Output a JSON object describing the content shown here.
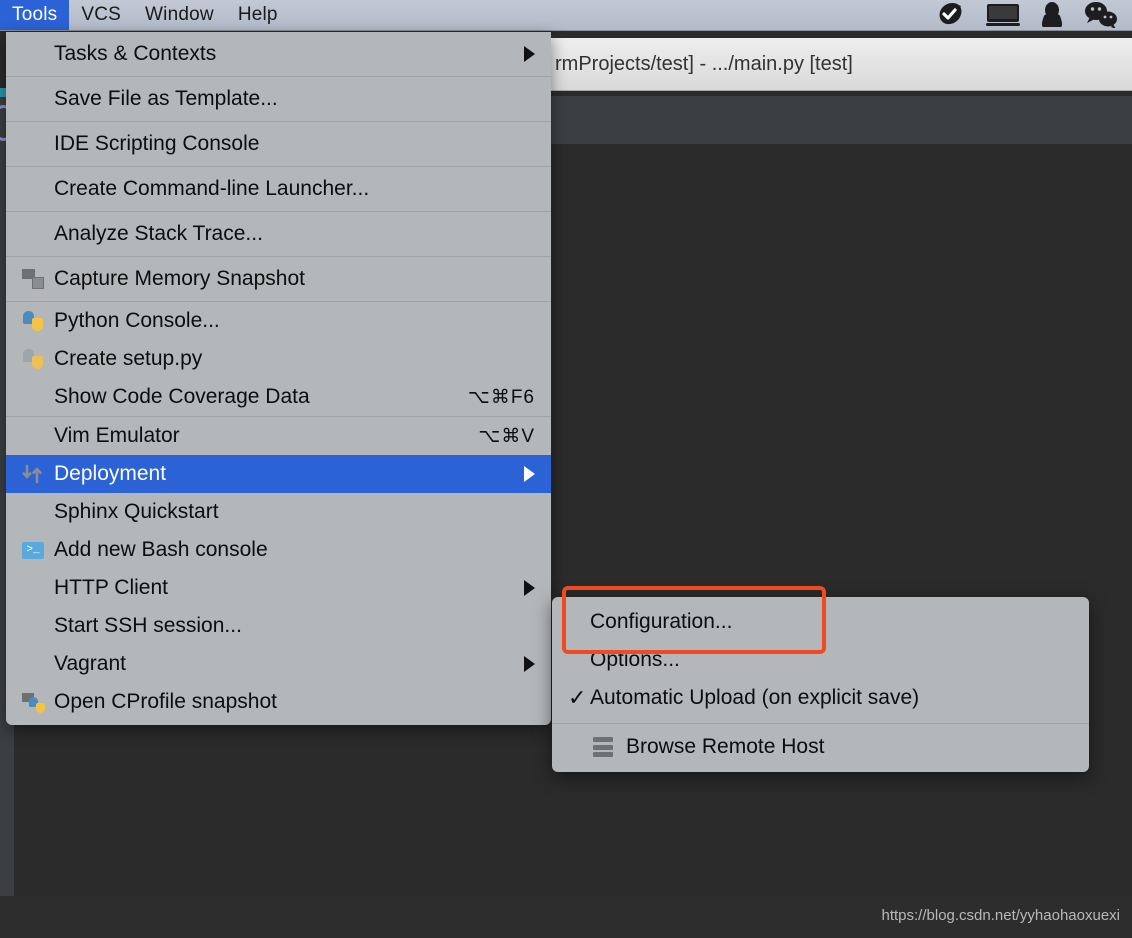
{
  "menubar": {
    "items": [
      {
        "label": "Tools",
        "active": true
      },
      {
        "label": "VCS",
        "active": false
      },
      {
        "label": "Window",
        "active": false
      },
      {
        "label": "Help",
        "active": false
      }
    ],
    "status_icons": [
      "checkmark-badge-icon",
      "display-monitor-icon",
      "qq-penguin-icon",
      "wechat-icon"
    ]
  },
  "titlebar": {
    "text": "rmProjects/test] - .../main.py [test]"
  },
  "tools_menu": {
    "items": [
      {
        "label": "Tasks & Contexts",
        "icon": "none",
        "shortcut": "",
        "submenu": true,
        "separator_below": true,
        "selected": false
      },
      {
        "label": "Save File as Template...",
        "icon": "none",
        "shortcut": "",
        "submenu": false,
        "separator_below": true,
        "selected": false
      },
      {
        "label": "IDE Scripting Console",
        "icon": "none",
        "shortcut": "",
        "submenu": false,
        "separator_below": true,
        "selected": false
      },
      {
        "label": "Create Command-line Launcher...",
        "icon": "none",
        "shortcut": "",
        "submenu": false,
        "separator_below": true,
        "selected": false
      },
      {
        "label": "Analyze Stack Trace...",
        "icon": "none",
        "shortcut": "",
        "submenu": false,
        "separator_below": true,
        "selected": false
      },
      {
        "label": "Capture Memory Snapshot",
        "icon": "memory-chip-save-icon",
        "shortcut": "",
        "submenu": false,
        "separator_below": true,
        "selected": false
      },
      {
        "label": "Python Console...",
        "icon": "python-icon",
        "shortcut": "",
        "submenu": false,
        "separator_below": false,
        "selected": false,
        "compact": true
      },
      {
        "label": "Create setup.py",
        "icon": "python-file-icon",
        "shortcut": "",
        "submenu": false,
        "separator_below": false,
        "selected": false,
        "compact": true
      },
      {
        "label": "Show Code Coverage Data",
        "icon": "none",
        "shortcut": "⌥⌘F6",
        "submenu": false,
        "separator_below": true,
        "selected": false,
        "compact": true
      },
      {
        "label": "Vim Emulator",
        "icon": "none",
        "shortcut": "⌥⌘V",
        "submenu": false,
        "separator_below": false,
        "selected": false,
        "compact": true
      },
      {
        "label": "Deployment",
        "icon": "deploy-arrows-icon",
        "shortcut": "",
        "submenu": true,
        "separator_below": false,
        "selected": true,
        "compact": true
      },
      {
        "label": "Sphinx Quickstart",
        "icon": "none",
        "shortcut": "",
        "submenu": false,
        "separator_below": false,
        "selected": false,
        "compact": true
      },
      {
        "label": "Add new Bash console",
        "icon": "terminal-icon",
        "shortcut": "",
        "submenu": false,
        "separator_below": false,
        "selected": false,
        "compact": true
      },
      {
        "label": "HTTP Client",
        "icon": "none",
        "shortcut": "",
        "submenu": true,
        "separator_below": false,
        "selected": false,
        "compact": true
      },
      {
        "label": "Start SSH session...",
        "icon": "none",
        "shortcut": "",
        "submenu": false,
        "separator_below": false,
        "selected": false,
        "compact": true
      },
      {
        "label": "Vagrant",
        "icon": "none",
        "shortcut": "",
        "submenu": true,
        "separator_below": false,
        "selected": false,
        "compact": true
      },
      {
        "label": "Open CProfile snapshot",
        "icon": "cprofile-python-icon",
        "shortcut": "",
        "submenu": false,
        "separator_below": false,
        "selected": false,
        "compact": true
      }
    ]
  },
  "deployment_submenu": {
    "items": [
      {
        "label": "Configuration...",
        "checked": false,
        "icon": "none",
        "highlighted": true
      },
      {
        "label": "Options...",
        "checked": false,
        "icon": "none",
        "highlighted": false
      },
      {
        "label": "Automatic Upload (on explicit save)",
        "checked": true,
        "icon": "none",
        "highlighted": false
      }
    ],
    "footer_items": [
      {
        "label": "Browse Remote Host",
        "icon": "server-stack-icon"
      }
    ]
  },
  "watermark": {
    "text": "https://blog.csdn.net/yyhaohaoxuexi"
  },
  "colors": {
    "menu_bg": "#b4b7ba",
    "selection_blue": "#2b62d6",
    "highlight_red": "#ef4a22",
    "ide_dark": "#2b2b2b",
    "ide_toolbar": "#3c3f41"
  }
}
